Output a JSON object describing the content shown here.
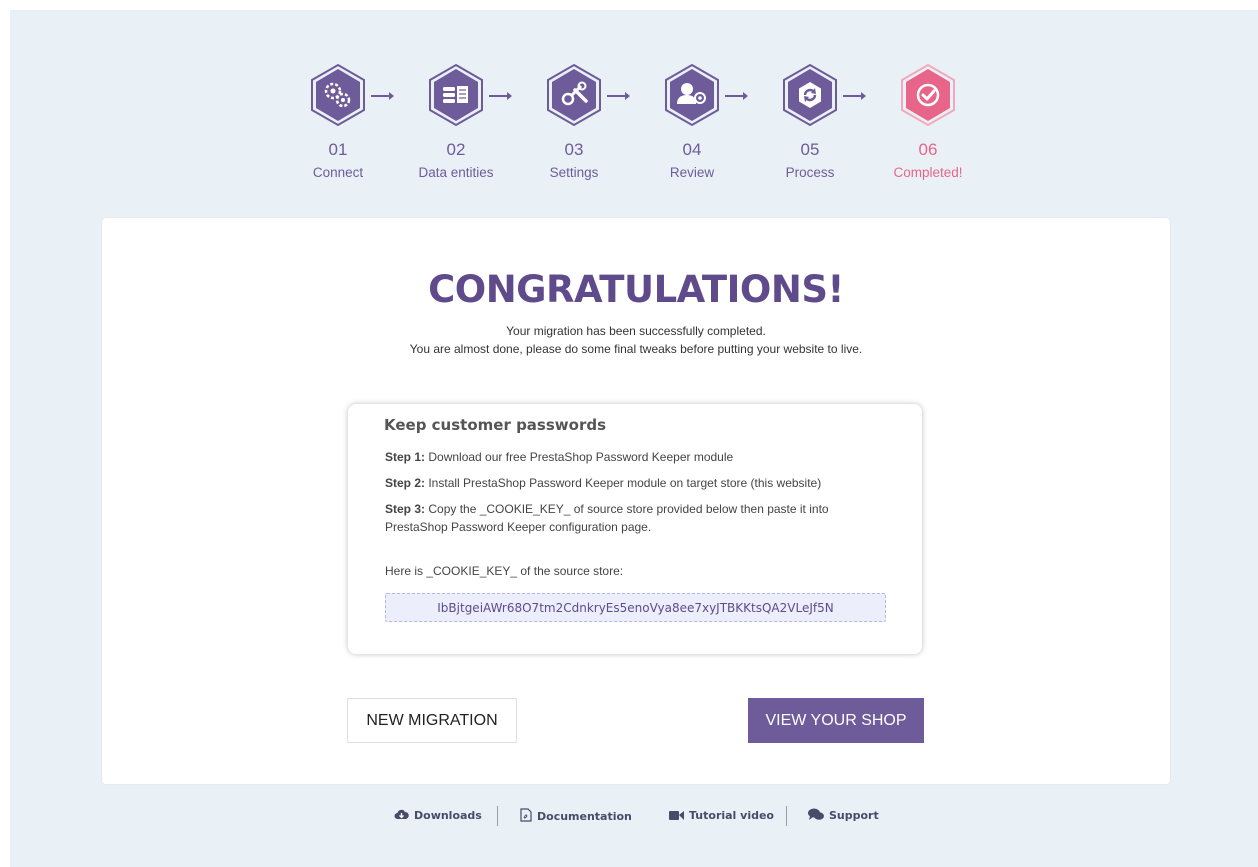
{
  "steps": [
    {
      "num": "01",
      "label": "Connect",
      "icon": "gears-icon"
    },
    {
      "num": "02",
      "label": "Data entities",
      "icon": "database-icon"
    },
    {
      "num": "03",
      "label": "Settings",
      "icon": "tools-icon"
    },
    {
      "num": "04",
      "label": "Review",
      "icon": "user-review-icon"
    },
    {
      "num": "05",
      "label": "Process",
      "icon": "sync-icon"
    },
    {
      "num": "06",
      "label": "Completed!",
      "icon": "check-circle-icon"
    }
  ],
  "colors": {
    "primary": "#6e5b9a",
    "completed": "#e8658a",
    "background": "#eaf1f6"
  },
  "main": {
    "heading": "CONGRATULATIONS!",
    "line1": "Your migration has been successfully completed.",
    "line2": "You are almost done, please do some final tweaks before putting your website to live."
  },
  "password_box": {
    "title": "Keep customer passwords",
    "step1_label": "Step 1:",
    "step1_text": " Download our free PrestaShop Password Keeper module",
    "step2_label": "Step 2:",
    "step2_text": " Install PrestaShop Password Keeper module on target store (this website)",
    "step3_label": "Step 3:",
    "step3_text": " Copy the _COOKIE_KEY_ of source store provided below then paste it into PrestaShop Password Keeper configuration page.",
    "cookie_label": "Here is _COOKIE_KEY_ of the source store:",
    "cookie_value": "IbBjtgeiAWr68O7tm2CdnkryEs5enoVya8ee7xyJTBKKtsQA2VLeJf5N"
  },
  "buttons": {
    "new_migration": "NEW MIGRATION",
    "view_shop": "VIEW YOUR SHOP"
  },
  "footer": {
    "downloads": "Downloads",
    "documentation": "Documentation",
    "tutorial": "Tutorial video",
    "support": "Support"
  }
}
